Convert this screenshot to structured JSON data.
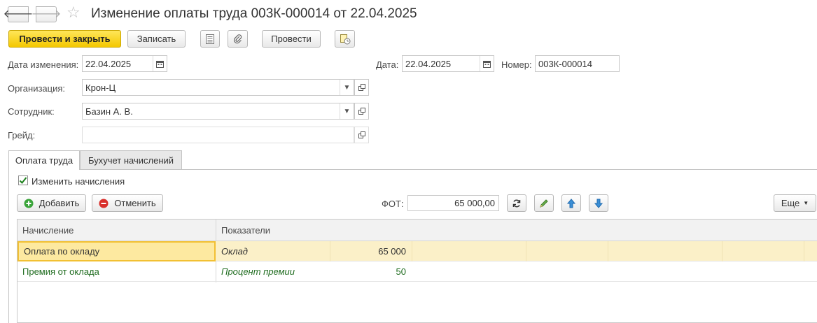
{
  "window": {
    "title": "Изменение оплаты труда 003К-000014 от 22.04.2025"
  },
  "toolbar": {
    "post_and_close": "Провести и закрыть",
    "save": "Записать",
    "post": "Провести"
  },
  "form": {
    "change_date_label": "Дата изменения:",
    "change_date_value": "22.04.2025",
    "date_label": "Дата:",
    "date_value": "22.04.2025",
    "number_label": "Номер:",
    "number_value": "003К-000014",
    "organization_label": "Организация:",
    "organization_value": "Крон-Ц",
    "employee_label": "Сотрудник:",
    "employee_value": "Базин А. В.",
    "grade_label": "Грейд:",
    "grade_value": ""
  },
  "tabs": [
    {
      "label": "Оплата труда",
      "active": true
    },
    {
      "label": "Бухучет начислений",
      "active": false
    }
  ],
  "pay_tab": {
    "change_accruals_label": "Изменить начисления",
    "change_accruals_checked": true,
    "add_button": "Добавить",
    "cancel_button": "Отменить",
    "fot_label": "ФОТ:",
    "fot_value": "65 000,00",
    "more_button": "Еще"
  },
  "table": {
    "columns": [
      "Начисление",
      "Показатели"
    ],
    "rows": [
      {
        "accrual": "Оплата по окладу",
        "indicator": "Оклад",
        "value": "65 000",
        "selected": true
      },
      {
        "accrual": "Премия от оклада",
        "indicator": "Процент премии",
        "value": "50",
        "selected": false
      }
    ]
  },
  "colors": {
    "primary_button": "#f4c800",
    "selected_row": "#fbf0c8",
    "green_text": "#1e6b1e"
  }
}
